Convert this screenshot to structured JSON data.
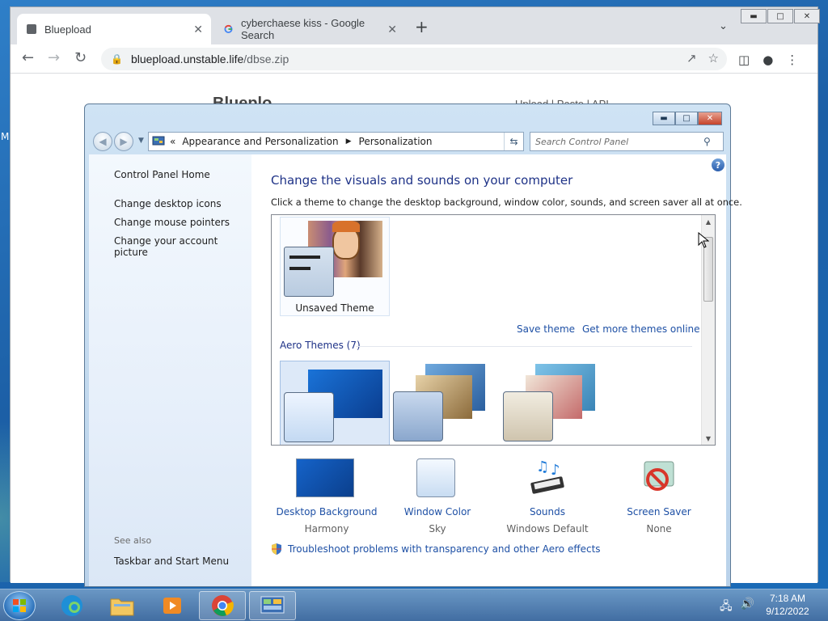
{
  "desktop": {
    "edge_letter": "M"
  },
  "browser": {
    "tabs": [
      {
        "title": "Bluepload",
        "active": true,
        "close": "✕"
      },
      {
        "title": "cyberchaese kiss - Google Search",
        "active": false,
        "close": "✕"
      }
    ],
    "new_tab": "+",
    "url_host": "bluepload.unstable.life",
    "url_path": "/dbse.zip",
    "page": {
      "title": "Blueplo",
      "links": "Upload | Paste | API"
    }
  },
  "control_panel": {
    "address": {
      "overflow": "«",
      "crumbs": [
        "Appearance and Personalization",
        "Personalization"
      ]
    },
    "search_placeholder": "Search Control Panel",
    "left_nav": {
      "home": "Control Panel Home",
      "links": [
        "Change desktop icons",
        "Change mouse pointers",
        "Change your account picture"
      ],
      "see_also_label": "See also",
      "see_also_links": [
        "Taskbar and Start Menu"
      ]
    },
    "main": {
      "title": "Change the visuals and sounds on your computer",
      "subtitle": "Click a theme to change the desktop background, window color, sounds, and screen saver all at once.",
      "unsaved_theme": "Unsaved Theme",
      "save_theme": "Save theme",
      "get_more": "Get more themes online",
      "aero_header": "Aero Themes (7)"
    },
    "bottom": [
      {
        "label": "Desktop Background",
        "value": "Harmony"
      },
      {
        "label": "Window Color",
        "value": "Sky"
      },
      {
        "label": "Sounds",
        "value": "Windows Default"
      },
      {
        "label": "Screen Saver",
        "value": "None"
      }
    ],
    "troubleshoot": "Troubleshoot problems with transparency and other Aero effects"
  },
  "taskbar": {
    "time": "7:18 AM",
    "date": "9/12/2022"
  },
  "colors": {
    "link": "#1e50a5",
    "title": "#1e3287",
    "desktop": "#1c5fa6"
  }
}
